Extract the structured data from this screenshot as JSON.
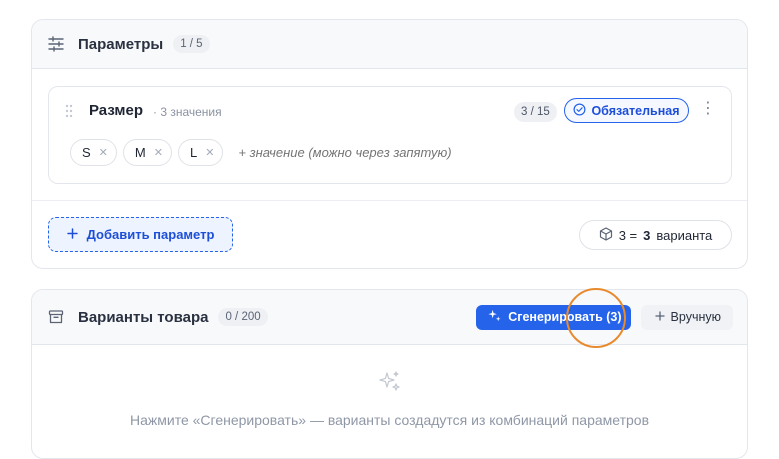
{
  "params_section": {
    "title": "Параметры",
    "count_badge": "1 / 5",
    "icon": "sliders-icon",
    "parameter": {
      "name": "Размер",
      "values_count": "· 3 значения",
      "fraction": "3 / 15",
      "required_label": "Обязательная",
      "values": [
        "S",
        "M",
        "L"
      ],
      "value_placeholder": "+ значение (можно через запятую)"
    },
    "add_button_label": "Добавить параметр",
    "combo_prefix": "3 =",
    "combo_count": "3",
    "combo_suffix": "варианта"
  },
  "variants_section": {
    "title": "Варианты товара",
    "count_badge": "0 / 200",
    "icon": "archive-icon",
    "generate_label": "Сгенерировать (3)",
    "manual_label": "Вручную",
    "empty_text": "Нажмите «Сгенерировать» — варианты создадутся из комбинаций параметров"
  },
  "colors": {
    "accent": "#2563eb",
    "highlight": "#e88a2e"
  }
}
